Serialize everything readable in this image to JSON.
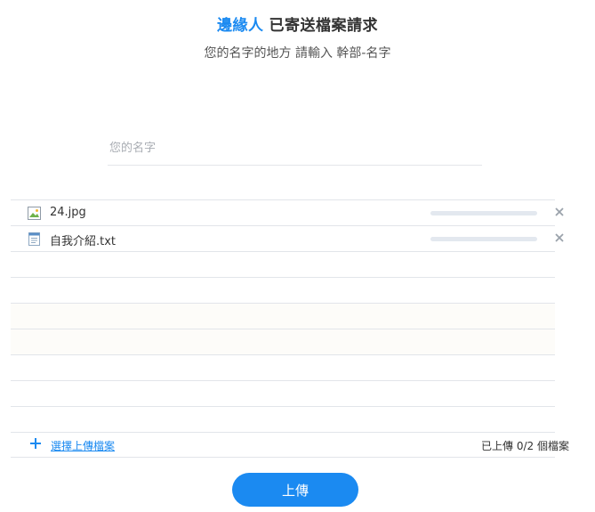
{
  "header": {
    "sender": "邊緣人",
    "title": "已寄送檔案請求"
  },
  "subtitle": "您的名字的地方 請輸入 幹部-名字",
  "name_input": {
    "placeholder": "您的名字",
    "value": ""
  },
  "files": [
    {
      "name": "24.jpg",
      "icon": "image-file-icon",
      "progress": 0
    },
    {
      "name": "自我介紹.txt",
      "icon": "text-file-icon",
      "progress": 0
    }
  ],
  "empty_rows": 7,
  "footer": {
    "select_label": "選擇上傳檔案",
    "status": "已上傳 0/2 個檔案"
  },
  "upload_button_label": "上傳",
  "colors": {
    "accent": "#1b8af1",
    "progress_track": "#e3e8ef",
    "divider": "#e2e5ea"
  }
}
